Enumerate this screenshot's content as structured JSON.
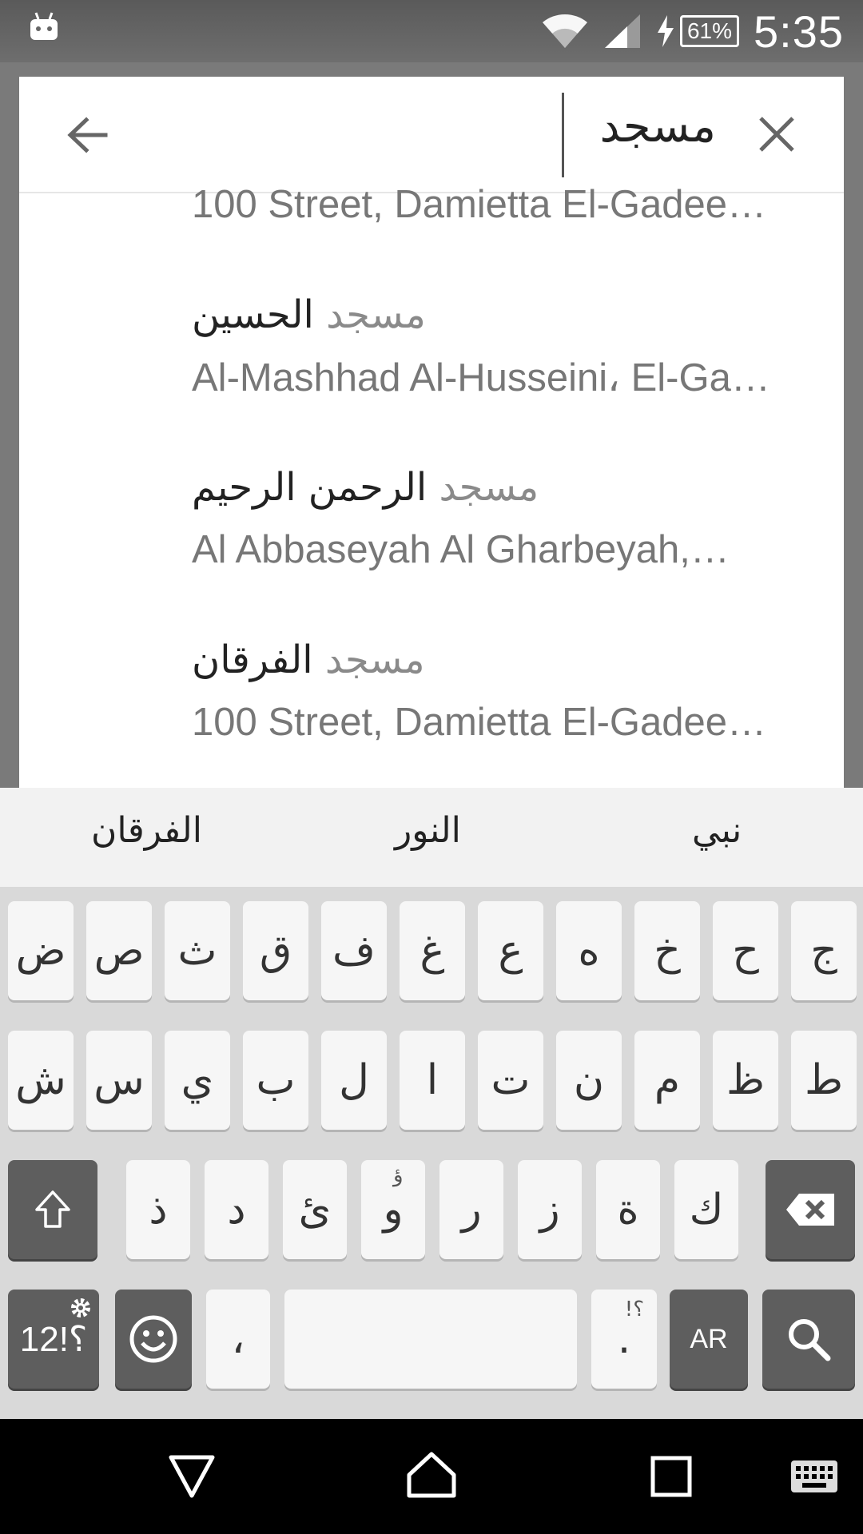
{
  "status_bar": {
    "time": "5:35",
    "battery_percent": "61%",
    "icons": [
      "android-icon",
      "wifi-icon",
      "signal-icon",
      "charging-icon",
      "battery-icon"
    ]
  },
  "search": {
    "query": "مسجد",
    "back_icon": "arrow-left-icon",
    "clear_icon": "close-icon"
  },
  "results": [
    {
      "title_query": "",
      "title_rest": "",
      "subtitle": "100 Street, Damietta El-Gadee…"
    },
    {
      "title_query": "مسجد",
      "title_rest": "الحسين",
      "subtitle": "Al-Mashhad Al-Husseini، El-Ga…"
    },
    {
      "title_query": "مسجد",
      "title_rest": "الرحمن الرحيم",
      "subtitle": "Al Abbaseyah Al Gharbeyah,…"
    },
    {
      "title_query": "مسجد",
      "title_rest": "الفرقان",
      "subtitle": "100 Street, Damietta El-Gadee…"
    }
  ],
  "keyboard": {
    "suggestions": [
      "الفرقان",
      "النور",
      "نبي"
    ],
    "row1": [
      "ض",
      "ص",
      "ث",
      "ق",
      "ف",
      "غ",
      "ع",
      "ه",
      "خ",
      "ح",
      "ج"
    ],
    "row2": [
      "ش",
      "س",
      "ي",
      "ب",
      "ل",
      "ا",
      "ت",
      "ن",
      "م",
      "ظ",
      "ط"
    ],
    "row3": [
      "ذ",
      "د",
      "ئ",
      "و",
      "ر",
      "ز",
      "ة",
      "ك"
    ],
    "row3_hint": "ؤ",
    "symbols_label": "؟!12",
    "comma_label": "،",
    "period_label": ".",
    "period_hint": "!؟",
    "language_label": "AR"
  },
  "nav_bar": {
    "icons": [
      "back-triangle-icon",
      "home-icon",
      "recents-icon",
      "keyboard-icon"
    ]
  }
}
